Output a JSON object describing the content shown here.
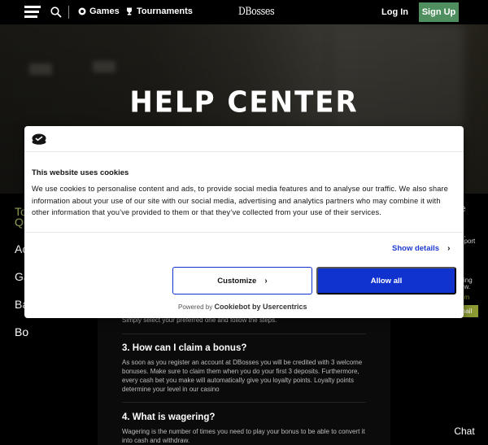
{
  "header": {
    "nav": [
      {
        "icon": "games-chip-icon",
        "label": "Games"
      },
      {
        "icon": "trophy-icon",
        "label": "Tournaments"
      }
    ],
    "logo": "DBosses",
    "login_label": "Log In",
    "signup_label": "Sign Up",
    "signup_color": "#4f8f5f"
  },
  "hero": {
    "title": "Help Center"
  },
  "sidebar": {
    "topic_heading": "To\nQu",
    "items": [
      {
        "label": "Ac"
      },
      {
        "label": "Ga"
      },
      {
        "label": "Ba"
      },
      {
        "label": "Bo"
      }
    ]
  },
  "faq": {
    "partial_text": "Simply select your preferred one and follow the steps.",
    "items": [
      {
        "question": "3. How can I claim a bonus?",
        "answer": "As soon as you register an account at DBosses you will be credited with 3 welcome bonuses. Make sure to claim them when you do your first 3 deposits. Furthermore, every cash bet you make will automatically give you loyalty points. Loyalty points determine your level in our casino"
      },
      {
        "question": "4. What is wagering?",
        "answer": "Wagering is the number of times you need to play your bonus to be able to convert it into cash and withdraw."
      }
    ]
  },
  "right_panel": {
    "fragments": [
      "e",
      "n,",
      "pport",
      "sing",
      "ow.",
      "om"
    ],
    "email_button_label": "nail",
    "email_button_color": "#8d9a34"
  },
  "chat_label": "Chat",
  "cookie_modal": {
    "title": "This website uses cookies",
    "text": "We use cookies to personalise content and ads, to provide social media features and to analyse our traffic. We also share information about your use of our site with our social media, advertising and analytics partners who may combine it with other information that you’ve provided to them or that they’ve collected from your use of their services.",
    "show_details_label": "Show details",
    "customize_label": "Customize",
    "allow_all_label": "Allow all",
    "powered_prefix": "Powered by",
    "powered_brand": "Cookiebot by Usercentrics",
    "accent_color": "#1032cf"
  }
}
